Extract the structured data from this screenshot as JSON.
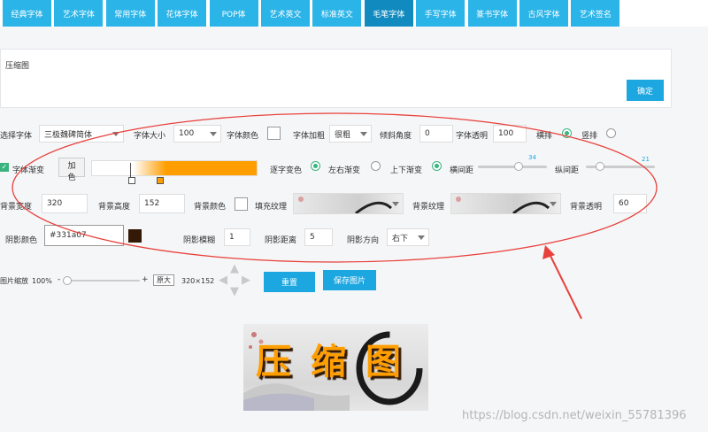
{
  "tabs": [
    "经典字体",
    "艺术字体",
    "常用字体",
    "花体字体",
    "POP体",
    "艺术英文",
    "标准英文",
    "毛笔字体",
    "手写字体",
    "篆书字体",
    "古风字体",
    "艺术签名"
  ],
  "active_tab": "毛笔字体",
  "text_input": {
    "value": "压缩图",
    "confirm_label": "确定"
  },
  "row1": {
    "font_label": "选择字体",
    "font_value": "三极魏碑简体",
    "size_label": "字体大小",
    "size_value": "100",
    "color_label": "字体颜色",
    "bold_label": "字体加粗",
    "bold_value": "很粗",
    "skew_label": "倾斜角度",
    "skew_value": "0",
    "opacity_label": "字体透明",
    "opacity_value": "100",
    "horizontal_label": "横排",
    "vertical_label": "竖排"
  },
  "row2": {
    "gradient_label": "字体渐变",
    "addcolor_label": "加色",
    "gradient_color": "#ff9e00",
    "char_color_label": "逐字变色",
    "lr_label": "左右渐变",
    "ud_label": "上下渐变",
    "hspace_label": "横间距",
    "hspace_value": "34",
    "vspace_label": "纵间距",
    "vspace_value": "21"
  },
  "row3": {
    "bg_width_label": "背景宽度",
    "bg_width_value": "320",
    "bg_height_label": "背景高度",
    "bg_height_value": "152",
    "bg_color_label": "背景颜色",
    "fill_texture_label": "填充纹理",
    "bg_texture_label": "背景纹理",
    "bg_opacity_label": "背景透明",
    "bg_opacity_value": "60"
  },
  "row4": {
    "shadow_color_label": "阴影颜色",
    "shadow_color_value": "#331a07",
    "shadow_swatch": "#331a07",
    "shadow_blur_label": "阴影模糊",
    "shadow_blur_value": "1",
    "shadow_dist_label": "阴影距离",
    "shadow_dist_value": "5",
    "shadow_dir_label": "阴影方向",
    "shadow_dir_value": "右下"
  },
  "zoom": {
    "label": "图片缩放",
    "value": "100%",
    "minus": "-",
    "plus": "+",
    "fit_label": "原大",
    "size_text": "320×152"
  },
  "actions": {
    "reset_label": "重置",
    "save_label": "保存图片"
  },
  "preview": {
    "text": "压缩图"
  },
  "watermark": "https://blog.csdn.net/weixin_55781396",
  "colors": {
    "accent": "#1ca7e1",
    "annotation": "#e8413b",
    "green": "#3bb37e"
  }
}
